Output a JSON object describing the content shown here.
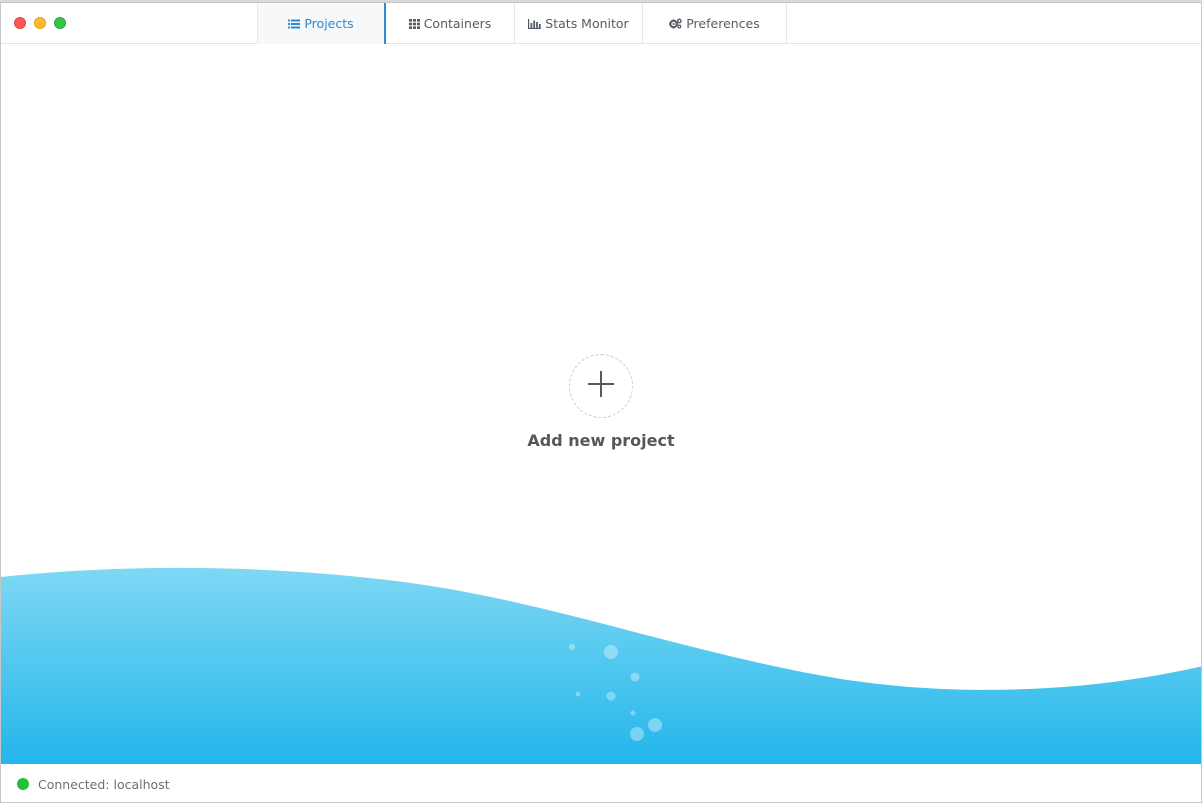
{
  "tabs": [
    {
      "label": "Projects",
      "icon": "list-icon",
      "active": true
    },
    {
      "label": "Containers",
      "icon": "grid-icon",
      "active": false
    },
    {
      "label": "Stats Monitor",
      "icon": "bar-chart-icon",
      "active": false
    },
    {
      "label": "Preferences",
      "icon": "gears-icon",
      "active": false
    }
  ],
  "main": {
    "add_project_label": "Add new project"
  },
  "status": {
    "text": "Connected: localhost",
    "color": "#22c13b"
  },
  "colors": {
    "accent": "#2d8ad6",
    "wave_top": "#7ed8f3",
    "wave_bottom": "#23b6eb"
  }
}
